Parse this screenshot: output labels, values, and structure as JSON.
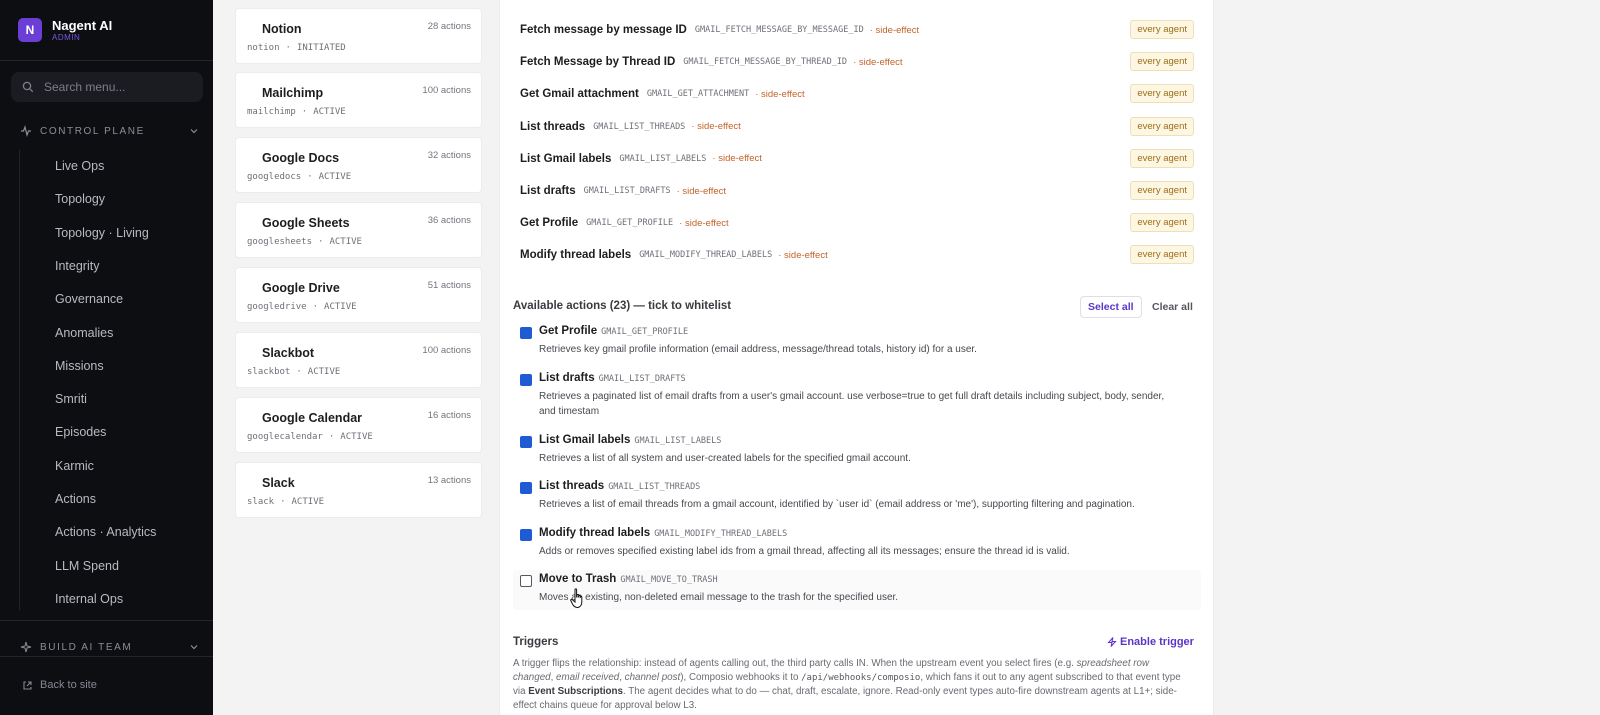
{
  "app": {
    "name": "Nagent AI",
    "role": "ADMIN",
    "logo_letter": "N"
  },
  "search": {
    "placeholder": "Search menu..."
  },
  "sidebar": {
    "section_control": "CONTROL PLANE",
    "section_build": "BUILD AI TEAM",
    "items": [
      {
        "label": "Live Ops",
        "icon": "activity-icon"
      },
      {
        "label": "Topology",
        "icon": "layers-icon"
      },
      {
        "label": "Topology · Living",
        "icon": "activity-icon"
      },
      {
        "label": "Integrity",
        "icon": "shield-icon"
      },
      {
        "label": "Governance",
        "icon": "shield-icon"
      },
      {
        "label": "Anomalies",
        "icon": "shield-icon"
      },
      {
        "label": "Missions",
        "icon": "trending-icon"
      },
      {
        "label": "Smriti",
        "icon": "globe-icon"
      },
      {
        "label": "Episodes",
        "icon": "activity-icon"
      },
      {
        "label": "Karmic",
        "icon": "scale-icon"
      },
      {
        "label": "Actions",
        "icon": "bolt-icon"
      },
      {
        "label": "Actions · Analytics",
        "icon": "bar-chart-icon"
      },
      {
        "label": "LLM Spend",
        "icon": "bar-chart-icon"
      },
      {
        "label": "Internal Ops",
        "icon": "sparkle-icon"
      }
    ],
    "back_label": "Back to site"
  },
  "integrations": [
    {
      "name": "Notion",
      "slug": "notion",
      "status": "INITIATED",
      "count": "28 actions",
      "icon": "warning-icon"
    },
    {
      "name": "Mailchimp",
      "slug": "mailchimp",
      "status": "ACTIVE",
      "count": "100 actions",
      "icon": "shield-check-icon"
    },
    {
      "name": "Google Docs",
      "slug": "googledocs",
      "status": "ACTIVE",
      "count": "32 actions",
      "icon": "shield-check-icon"
    },
    {
      "name": "Google Sheets",
      "slug": "googlesheets",
      "status": "ACTIVE",
      "count": "36 actions",
      "icon": "shield-check-icon"
    },
    {
      "name": "Google Drive",
      "slug": "googledrive",
      "status": "ACTIVE",
      "count": "51 actions",
      "icon": "shield-check-icon"
    },
    {
      "name": "Slackbot",
      "slug": "slackbot",
      "status": "ACTIVE",
      "count": "100 actions",
      "icon": "shield-check-icon"
    },
    {
      "name": "Google Calendar",
      "slug": "googlecalendar",
      "status": "ACTIVE",
      "count": "16 actions",
      "icon": "shield-check-icon"
    },
    {
      "name": "Slack",
      "slug": "slack",
      "status": "ACTIVE",
      "count": "13 actions",
      "icon": "shield-check-icon"
    }
  ],
  "sep": "·",
  "permissions": [
    {
      "name": "Fetch message by message ID",
      "code": "GMAIL_FETCH_MESSAGE_BY_MESSAGE_ID",
      "tag": "· side-effect",
      "scope": "every agent"
    },
    {
      "name": "Fetch Message by Thread ID",
      "code": "GMAIL_FETCH_MESSAGE_BY_THREAD_ID",
      "tag": "· side-effect",
      "scope": "every agent"
    },
    {
      "name": "Get Gmail attachment",
      "code": "GMAIL_GET_ATTACHMENT",
      "tag": "· side-effect",
      "scope": "every agent"
    },
    {
      "name": "List threads",
      "code": "GMAIL_LIST_THREADS",
      "tag": "· side-effect",
      "scope": "every agent"
    },
    {
      "name": "List Gmail labels",
      "code": "GMAIL_LIST_LABELS",
      "tag": "· side-effect",
      "scope": "every agent"
    },
    {
      "name": "List drafts",
      "code": "GMAIL_LIST_DRAFTS",
      "tag": "· side-effect",
      "scope": "every agent"
    },
    {
      "name": "Get Profile",
      "code": "GMAIL_GET_PROFILE",
      "tag": "· side-effect",
      "scope": "every agent"
    },
    {
      "name": "Modify thread labels",
      "code": "GMAIL_MODIFY_THREAD_LABELS",
      "tag": "· side-effect",
      "scope": "every agent"
    }
  ],
  "available": {
    "title": "Available actions (23) — tick to whitelist",
    "select_all": "Select all",
    "clear_all": "Clear all",
    "actions": [
      {
        "name": "Get Profile",
        "code": "GMAIL_GET_PROFILE",
        "checked": true,
        "desc": "Retrieves key gmail profile information (email address, message/thread totals, history id) for a user."
      },
      {
        "name": "List drafts",
        "code": "GMAIL_LIST_DRAFTS",
        "checked": true,
        "desc": "Retrieves a paginated list of email drafts from a user's gmail account. use verbose=true to get full draft details including subject, body, sender, and timestam"
      },
      {
        "name": "List Gmail labels",
        "code": "GMAIL_LIST_LABELS",
        "checked": true,
        "desc": "Retrieves a list of all system and user-created labels for the specified gmail account."
      },
      {
        "name": "List threads",
        "code": "GMAIL_LIST_THREADS",
        "checked": true,
        "desc": "Retrieves a list of email threads from a gmail account, identified by `user id` (email address or 'me'), supporting filtering and pagination."
      },
      {
        "name": "Modify thread labels",
        "code": "GMAIL_MODIFY_THREAD_LABELS",
        "checked": true,
        "desc": "Adds or removes specified existing label ids from a gmail thread, affecting all its messages; ensure the thread id is valid."
      },
      {
        "name": "Move to Trash",
        "code": "GMAIL_MOVE_TO_TRASH",
        "checked": false,
        "desc": "Moves an existing, non-deleted email message to the trash for the specified user."
      }
    ]
  },
  "triggers": {
    "title": "Triggers",
    "enable_label": "Enable trigger",
    "p1": "A trigger flips the relationship: instead of agents calling out, the third party calls IN. When the upstream event you select fires (e.g. ",
    "e1": "spreadsheet row changed",
    "c1": ", ",
    "e2": "email received",
    "c2": ", ",
    "e3": "channel post",
    "p2": "), Composio webhooks it to ",
    "code": "/api/webhooks/composio",
    "p3": ", which fans it out to any agent subscribed to that event type via ",
    "bold": "Event Subscriptions",
    "p4": ". The agent decides what to do — chat, draft, escalate, ignore. Read-only event types auto-fire downstream agents at L1+; side-effect chains queue for approval below L3."
  },
  "colors": {
    "accent": "#5b34c8",
    "sidebar_bg": "#0d0e12",
    "checkbox": "#1f5bd2",
    "side_effect": "#c2642c",
    "badge_bg": "#fdf6e3"
  }
}
